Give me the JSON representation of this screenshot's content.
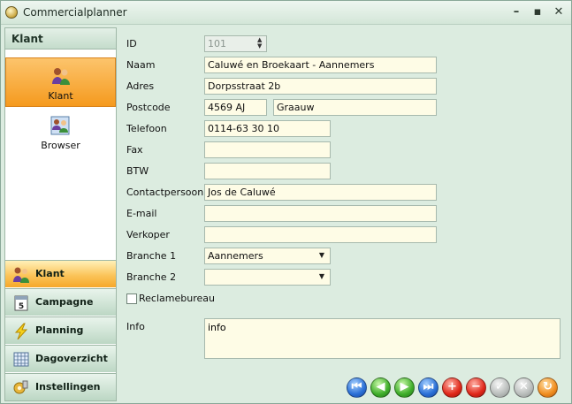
{
  "window": {
    "title": "Commercialplanner"
  },
  "sidebar": {
    "header": "Klant",
    "items": [
      {
        "label": "Klant",
        "icon": "people-icon",
        "active": true
      },
      {
        "label": "Browser",
        "icon": "people-grid-icon",
        "active": false
      }
    ],
    "nav": [
      {
        "label": "Klant",
        "icon": "people-icon",
        "active": true
      },
      {
        "label": "Campagne",
        "icon": "calendar-icon",
        "active": false
      },
      {
        "label": "Planning",
        "icon": "lightning-icon",
        "active": false
      },
      {
        "label": "Dagoverzicht",
        "icon": "grid-calendar-icon",
        "active": false
      },
      {
        "label": "Instellingen",
        "icon": "settings-icon",
        "active": false
      }
    ]
  },
  "form": {
    "id_label": "ID",
    "id_value": "101",
    "naam_label": "Naam",
    "naam_value": "Caluwé en Broekaart - Aannemers",
    "adres_label": "Adres",
    "adres_value": "Dorpsstraat 2b",
    "postcode_label": "Postcode",
    "postcode_value": "4569 AJ",
    "plaats_value": "Graauw",
    "telefoon_label": "Telefoon",
    "telefoon_value": "0114-63 30 10",
    "fax_label": "Fax",
    "fax_value": "",
    "btw_label": "BTW",
    "btw_value": "",
    "contact_label": "Contactpersoon",
    "contact_value": "Jos de Caluwé",
    "email_label": "E-mail",
    "email_value": "",
    "verkoper_label": "Verkoper",
    "verkoper_value": "",
    "branche1_label": "Branche 1",
    "branche1_value": "Aannemers",
    "branche2_label": "Branche 2",
    "branche2_value": "",
    "reclame_label": "Reclamebureau",
    "reclame_checked": false,
    "info_label": "Info",
    "info_value": "info"
  },
  "toolbar": [
    {
      "name": "first-record-button",
      "icon": "first-icon",
      "glyph": "⏮",
      "color": "blue"
    },
    {
      "name": "previous-record-button",
      "icon": "previous-icon",
      "glyph": "◀",
      "color": "green"
    },
    {
      "name": "next-record-button",
      "icon": "next-icon",
      "glyph": "▶",
      "color": "green"
    },
    {
      "name": "last-record-button",
      "icon": "last-icon",
      "glyph": "⏭",
      "color": "blue"
    },
    {
      "name": "add-record-button",
      "icon": "plus-icon",
      "glyph": "+",
      "color": "red"
    },
    {
      "name": "delete-record-button",
      "icon": "minus-icon",
      "glyph": "−",
      "color": "red"
    },
    {
      "name": "save-record-button",
      "icon": "check-icon",
      "glyph": "✓",
      "color": "grey"
    },
    {
      "name": "cancel-record-button",
      "icon": "close-icon",
      "glyph": "✕",
      "color": "grey"
    },
    {
      "name": "refresh-button",
      "icon": "refresh-icon",
      "glyph": "↻",
      "color": "orange"
    }
  ]
}
